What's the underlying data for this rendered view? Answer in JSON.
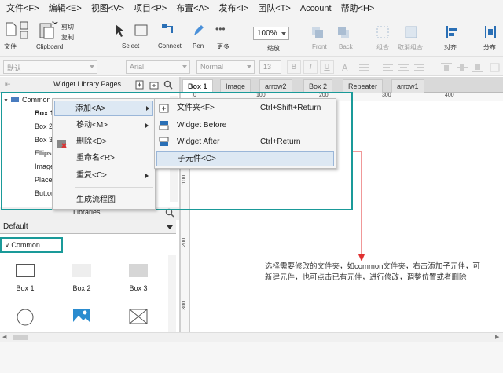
{
  "menubar": [
    "文件<F>",
    "编辑<E>",
    "视图<V>",
    "项目<P>",
    "布置<A>",
    "发布<I>",
    "团队<T>",
    "Account",
    "帮助<H>"
  ],
  "toolbar": {
    "file": "文件",
    "clipboard": "Clipboard",
    "cut": "剪切",
    "copy": "复制",
    "select": "Select",
    "connect": "Connect",
    "pen": "Pen",
    "more": "更多",
    "zoom_value": "100%",
    "zoom_label": "缩放",
    "front": "Front",
    "back": "Back",
    "group": "组合",
    "ungroup": "取消组合",
    "align": "对齐",
    "distribute": "分布"
  },
  "formatbar": {
    "style": "默认",
    "font": "Arial",
    "weight": "Normal",
    "size": "13",
    "bold": "B",
    "italic": "I",
    "underline": "U"
  },
  "pages_panel": {
    "title": "Widget Library Pages",
    "root": "Common",
    "items": [
      "Box 1",
      "Box 2",
      "Box 3",
      "Ellipse",
      "Image",
      "Placeholder",
      "Button"
    ]
  },
  "libraries": {
    "title": "Libraries",
    "selected": "Default",
    "group": "Common",
    "widgets": [
      "Box 1",
      "Box 2",
      "Box 3"
    ]
  },
  "tabs": [
    "Box 1",
    "Image",
    "arrow2",
    "Box 2",
    "Repeater",
    "arrow1"
  ],
  "ruler": {
    "h": [
      "0",
      "100",
      "200",
      "300",
      "400"
    ],
    "v": [
      "100",
      "200",
      "300"
    ]
  },
  "context_menu": {
    "items": [
      {
        "label": "添加<A>"
      },
      {
        "label": "移动<M>"
      },
      {
        "label": "删除<D>"
      },
      {
        "label": "重命名<R>"
      },
      {
        "label": "重复<C>"
      },
      {
        "label": "生成流程图"
      }
    ]
  },
  "submenu": {
    "items": [
      {
        "label": "文件夹<F>",
        "shortcut": "Ctrl+Shift+Return"
      },
      {
        "label": "Widget Before",
        "shortcut": ""
      },
      {
        "label": "Widget After",
        "shortcut": "Ctrl+Return"
      },
      {
        "label": "子元件<C>",
        "shortcut": ""
      }
    ]
  },
  "annotation": "选择需要修改的文件夹，如common文件夹，右击添加子元件，可新建元件，也可点击已有元件，进行修改，调整位置或者删除",
  "colors": {
    "accent": "#1a9a99",
    "arrow": "#e03030",
    "highlight": "#dde8f3"
  }
}
